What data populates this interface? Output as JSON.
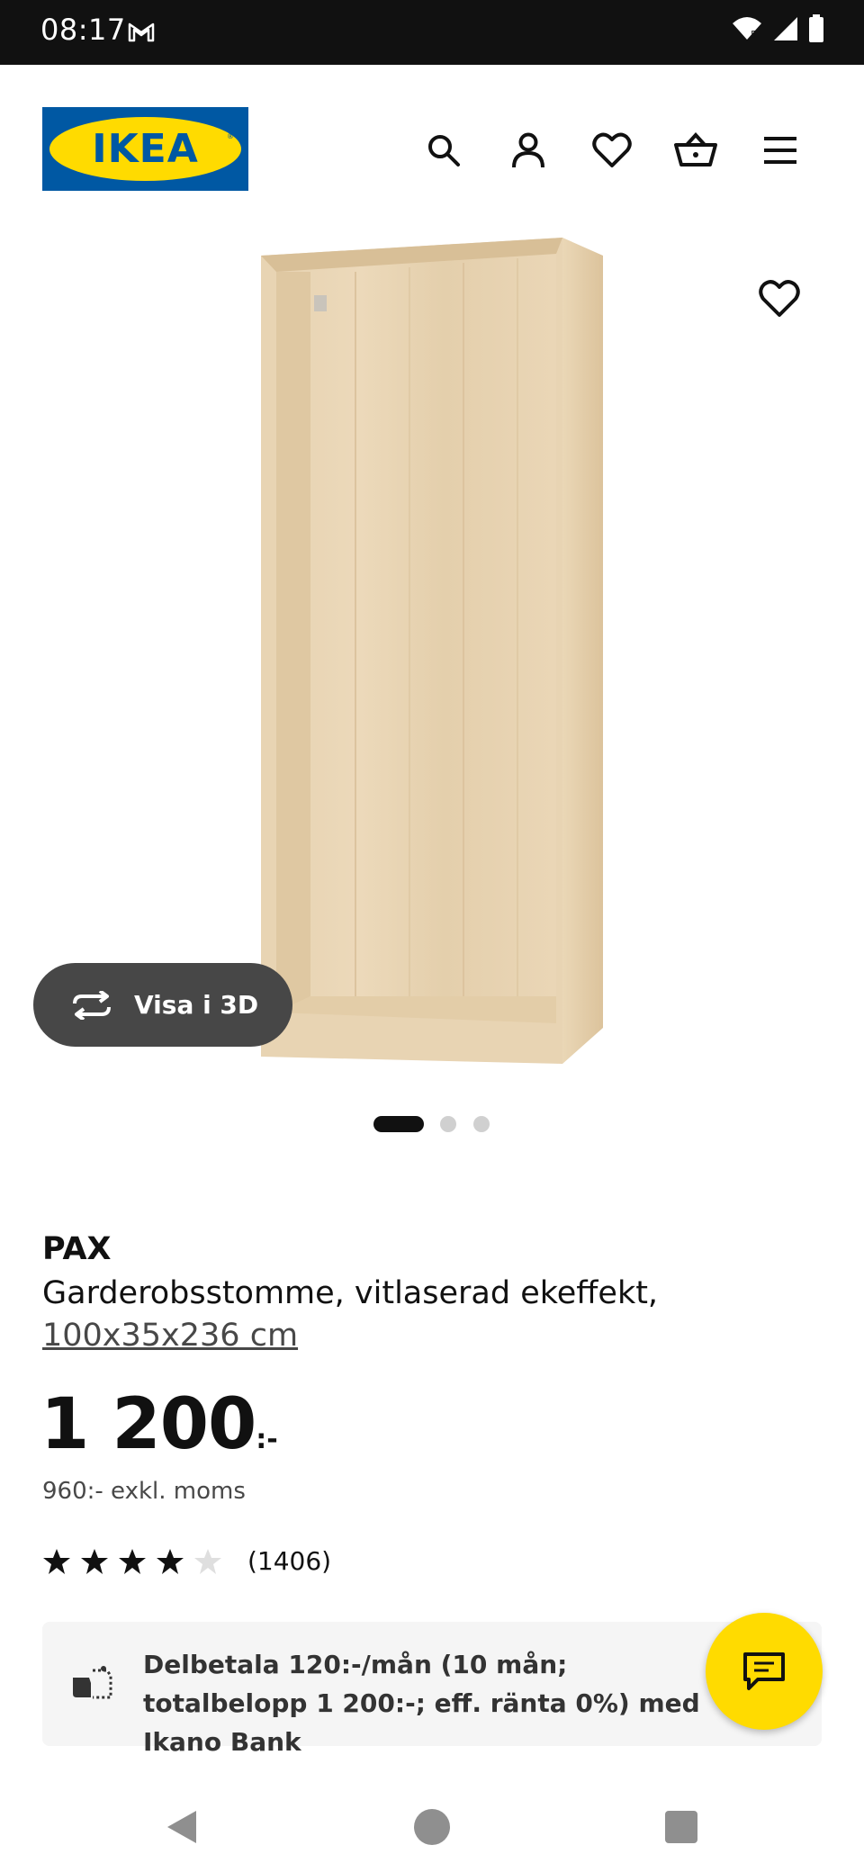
{
  "status_bar": {
    "time": "08:17",
    "icons": [
      "gmail-icon",
      "wifi-icon",
      "signal-icon",
      "battery-icon"
    ]
  },
  "header": {
    "logo_text": "IKEA",
    "icons": [
      "search-icon",
      "account-icon",
      "wishlist-icon",
      "cart-icon",
      "menu-icon"
    ]
  },
  "gallery": {
    "view_3d_label": "Visa i 3D",
    "slide_count": 3,
    "active_slide": 1
  },
  "product": {
    "name": "PAX",
    "description": "Garderobsstomme, vitlaserad ekeffekt,",
    "size": "100x35x236 cm",
    "price_integer": "1 200",
    "price_suffix": ":-",
    "price_excl_vat": "960:- exkl. moms",
    "rating_value": 4,
    "rating_max": 5,
    "review_count": "(1406)"
  },
  "installment": {
    "text": "Delbetala 120:-/mån (10 mån; totalbelopp 1 200:-; eff. ränta 0%) med Ikano Bank"
  },
  "colors": {
    "ikea_blue": "#0058a3",
    "ikea_yellow": "#ffdb00",
    "button_dark": "#474747"
  }
}
